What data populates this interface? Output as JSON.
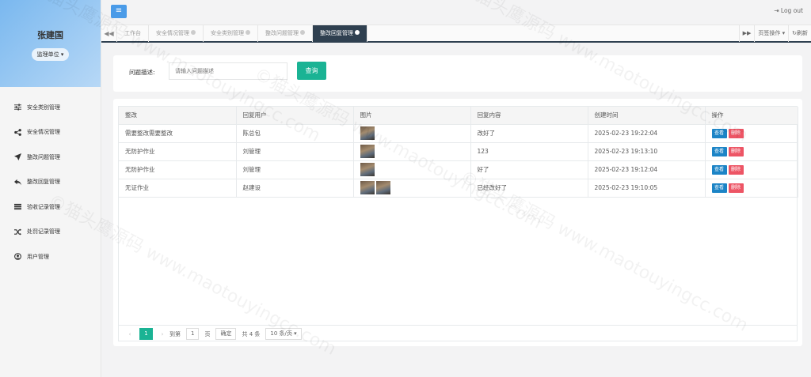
{
  "sidebar": {
    "user_name": "张建国",
    "role": "监理单位",
    "items": [
      {
        "label": "安全类别管理",
        "icon": "sliders-icon"
      },
      {
        "label": "安全情况管理",
        "icon": "share-icon"
      },
      {
        "label": "整改问题管理",
        "icon": "send-icon"
      },
      {
        "label": "整改回复管理",
        "icon": "reply-icon"
      },
      {
        "label": "验收记录管理",
        "icon": "list-icon"
      },
      {
        "label": "处罚记录管理",
        "icon": "shuffle-icon"
      },
      {
        "label": "用户管理",
        "icon": "user-circle-icon"
      }
    ]
  },
  "header": {
    "logout": "Log out"
  },
  "tabs": {
    "items": [
      "工作台",
      "安全情况管理",
      "安全类别管理",
      "整改问题管理",
      "整改回复管理"
    ],
    "active_index": 4,
    "page_ops": "页签操作",
    "refresh": "刷新"
  },
  "search": {
    "label": "问题描述:",
    "placeholder": "请输入问题描述",
    "button": "查询"
  },
  "table": {
    "columns": [
      "整改",
      "回复用户",
      "图片",
      "回复内容",
      "创建时间",
      "操作"
    ],
    "rows": [
      {
        "issue": "需要整改需要整改",
        "user": "陈总包",
        "images": 1,
        "content": "改好了",
        "time": "2025-02-23 19:22:04"
      },
      {
        "issue": "无防护作业",
        "user": "刘管理",
        "images": 1,
        "content": "123",
        "time": "2025-02-23 19:13:10"
      },
      {
        "issue": "无防护作业",
        "user": "刘管理",
        "images": 1,
        "content": "好了",
        "time": "2025-02-23 19:12:04"
      },
      {
        "issue": "无证作业",
        "user": "赵建设",
        "images": 2,
        "content": "已经改好了",
        "time": "2025-02-23 19:10:05"
      }
    ],
    "view_label": "查看",
    "delete_label": "删除"
  },
  "pager": {
    "current": "1",
    "goto_label": "到第",
    "page_input": "1",
    "page_unit": "页",
    "confirm": "确定",
    "total": "共 4 条",
    "page_size": "10 条/页"
  },
  "watermark": "©猫头鹰源码 www.maotouyingcc.com",
  "colors": {
    "primary": "#1ab394",
    "view": "#1c84c6",
    "delete": "#ed5565",
    "dark_tab": "#2f4050",
    "menu_button": "#4a9be8"
  }
}
